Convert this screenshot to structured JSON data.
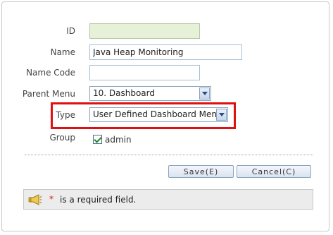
{
  "form": {
    "id": {
      "label": "ID",
      "value": ""
    },
    "name": {
      "label": "Name",
      "value": "Java Heap Monitoring"
    },
    "name_code": {
      "label": "Name Code",
      "value": ""
    },
    "parent_menu": {
      "label": "Parent Menu",
      "value": "10. Dashboard"
    },
    "type": {
      "label": "Type",
      "value": "User Defined Dashboard Menu"
    },
    "group": {
      "label": "Group",
      "value": "admin",
      "checked": true
    }
  },
  "buttons": {
    "save": "Save(E)",
    "cancel": "Cancel(C)"
  },
  "notice": {
    "asterisk": "*",
    "text": "is a required field.",
    "icon": "megaphone-icon"
  },
  "colors": {
    "highlight": "#e01010",
    "readonly_bg": "#e6f1d8",
    "panel_bg": "#ececec"
  }
}
